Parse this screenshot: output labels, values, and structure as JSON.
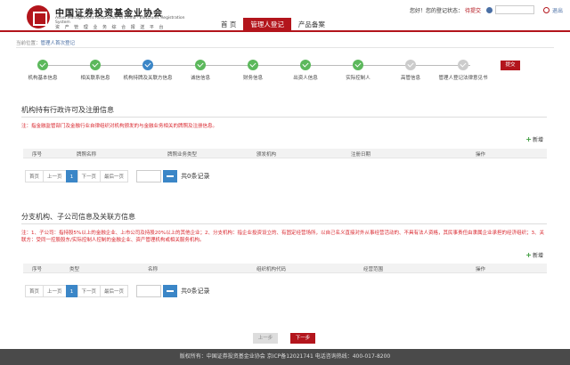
{
  "header": {
    "org_cn": "中国证券投资基金业协会",
    "org_en": "Asset Management Association of China · Electronic Registration System",
    "org_sub": "资 产 管 理 业 务 综 合 报 送 平 台",
    "nav": [
      "首 页",
      "管理人登记",
      "产品备案"
    ],
    "user_prefix": "您好！您的登记状态：",
    "user_status": "待提交",
    "logout": "退出"
  },
  "breadcrumb": {
    "prefix": "当前位置：",
    "current": "管理人首次登记"
  },
  "steps": [
    {
      "label": "机构基本信息",
      "state": "done"
    },
    {
      "label": "相关联系信息",
      "state": "done"
    },
    {
      "label": "机构持牌及关联方信息",
      "state": "current"
    },
    {
      "label": "诚信信息",
      "state": "done"
    },
    {
      "label": "财务信息",
      "state": "done"
    },
    {
      "label": "出资人信息",
      "state": "done"
    },
    {
      "label": "实际控制人",
      "state": "done"
    },
    {
      "label": "高管信息",
      "state": "todo"
    },
    {
      "label": "管理人登记法律意见书",
      "state": "todo"
    }
  ],
  "submit_label": "提交",
  "section1": {
    "title": "机构持有行政许可及注册信息",
    "note": "注：指金融监管部门及金融行业自律组织对机构颁发的与金融业务相关的牌照及注册信息。",
    "add_label": "新增",
    "columns": [
      "序号",
      "牌照名称",
      "牌照业务类型",
      "颁发机构",
      "注册日期",
      "操作"
    ]
  },
  "section2": {
    "title": "分支机构、子公司信息及关联方信息",
    "note": "注：1、子公司：指持股5%以上的金融企业、上市公司及持股20%以上的其他企业；2、分支机构：指企业投资设立的、有固定经营场所，以自己名义直接对外从事经营活动的、不具有法人资格，其民事责任由隶属企业承担的经济组织；3、关联方：受同一控股股东/实际控制人控制的金融企业、资产管理机构或相关服务机构。",
    "add_label": "新增",
    "columns": [
      "序号",
      "类型",
      "名称",
      "组织机构代码",
      "经营范围",
      "操作"
    ]
  },
  "pager": {
    "first": "首页",
    "prev": "上一页",
    "page": "1",
    "next": "下一页",
    "last": "最后一页",
    "total": "共0条记录"
  },
  "nav_buttons": {
    "prev": "上一步",
    "next": "下一步"
  },
  "footer": "版权所有：中国证券投资基金业协会   京ICP备12021741   电话咨询热线：400-017-8200"
}
